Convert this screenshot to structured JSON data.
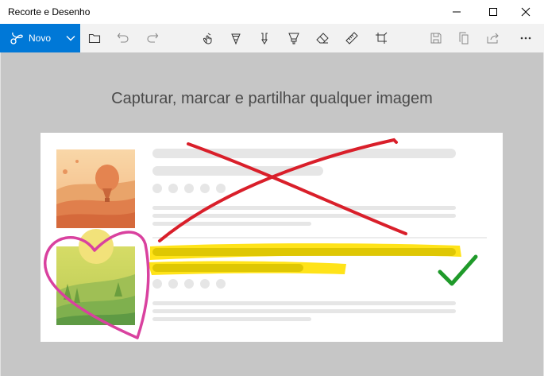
{
  "window": {
    "title": "Recorte e Desenho"
  },
  "toolbar": {
    "new_label": "Novo",
    "icons": [
      "open-folder-icon",
      "undo-icon",
      "redo-icon",
      "touch-writing-icon",
      "ballpoint-pen-icon",
      "pencil-icon",
      "highlighter-icon",
      "eraser-icon",
      "ruler-icon",
      "crop-icon",
      "save-icon",
      "copy-icon",
      "share-icon",
      "more-icon"
    ]
  },
  "main": {
    "headline": "Capturar, marcar e partilhar qualquer imagem"
  },
  "colors": {
    "accent": "#0078d7",
    "background": "#c6c6c6",
    "pen_red": "#d91f2a",
    "pen_pink": "#d9419f",
    "highlighter": "#ffe000",
    "check_green": "#1f9a2a"
  }
}
